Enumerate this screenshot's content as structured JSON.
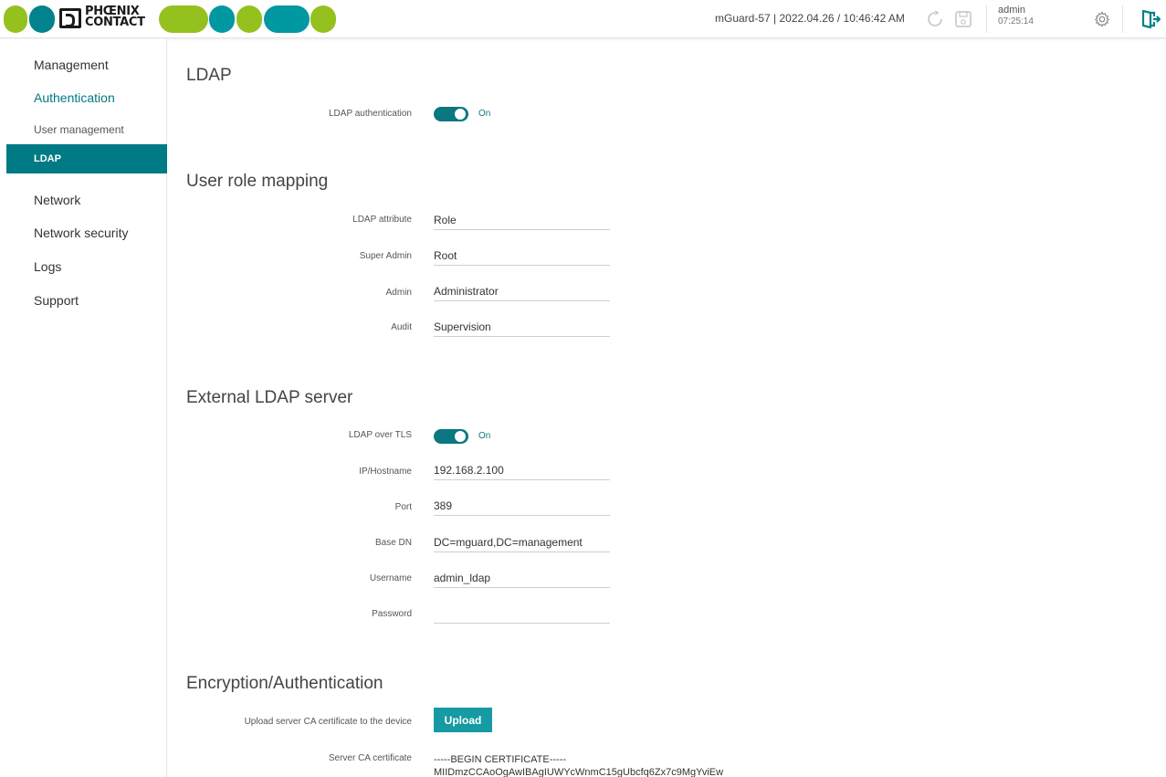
{
  "colors": {
    "accent": "#007a84",
    "toggle": "#0b7780",
    "button": "#169aa3",
    "logo_green": "#95c11f",
    "logo_teal": "#0098a1",
    "logo_teal_dark": "#00838c"
  },
  "header": {
    "logo_line1": "PHŒNIX",
    "logo_line2": "CONTACT",
    "device_info": "mGuard-57 | 2022.04.26 / 10:46:42 AM",
    "icons": [
      "refresh-icon",
      "save-icon",
      "gear-icon",
      "logout-icon"
    ],
    "user_name": "admin",
    "session_time": "07:25:14"
  },
  "sidebar": {
    "items": [
      {
        "label": "Management"
      },
      {
        "label": "Authentication"
      },
      {
        "label": "User management"
      },
      {
        "label": "LDAP"
      },
      {
        "label": "Network"
      },
      {
        "label": "Network security"
      },
      {
        "label": "Logs"
      },
      {
        "label": "Support"
      }
    ]
  },
  "ldap": {
    "title": "LDAP",
    "auth_label": "LDAP authentication",
    "auth_state": "On"
  },
  "role_mapping": {
    "title": "User role mapping",
    "ldap_attribute_label": "LDAP attribute",
    "ldap_attribute_value": "Role",
    "super_admin_label": "Super Admin",
    "super_admin_value": "Root",
    "admin_label": "Admin",
    "admin_value": "Administrator",
    "audit_label": "Audit",
    "audit_value": "Supervision"
  },
  "external": {
    "title": "External LDAP server",
    "tls_label": "LDAP over TLS",
    "tls_state": "On",
    "host_label": "IP/Hostname",
    "host_value": "192.168.2.100",
    "port_label": "Port",
    "port_value": "389",
    "basedn_label": "Base DN",
    "basedn_value": "DC=mguard,DC=management",
    "username_label": "Username",
    "username_value": "admin_ldap",
    "password_label": "Password",
    "password_value": ""
  },
  "encryption": {
    "title": "Encryption/Authentication",
    "upload_label": "Upload server CA certificate to the device",
    "upload_button": "Upload",
    "cert_label": "Server CA certificate",
    "cert_line1": "-----BEGIN CERTIFICATE-----",
    "cert_line2": "MIIDmzCCAoOgAwIBAgIUWYcWnmC15gUbcfq6Zx7c9MgYviEw"
  }
}
